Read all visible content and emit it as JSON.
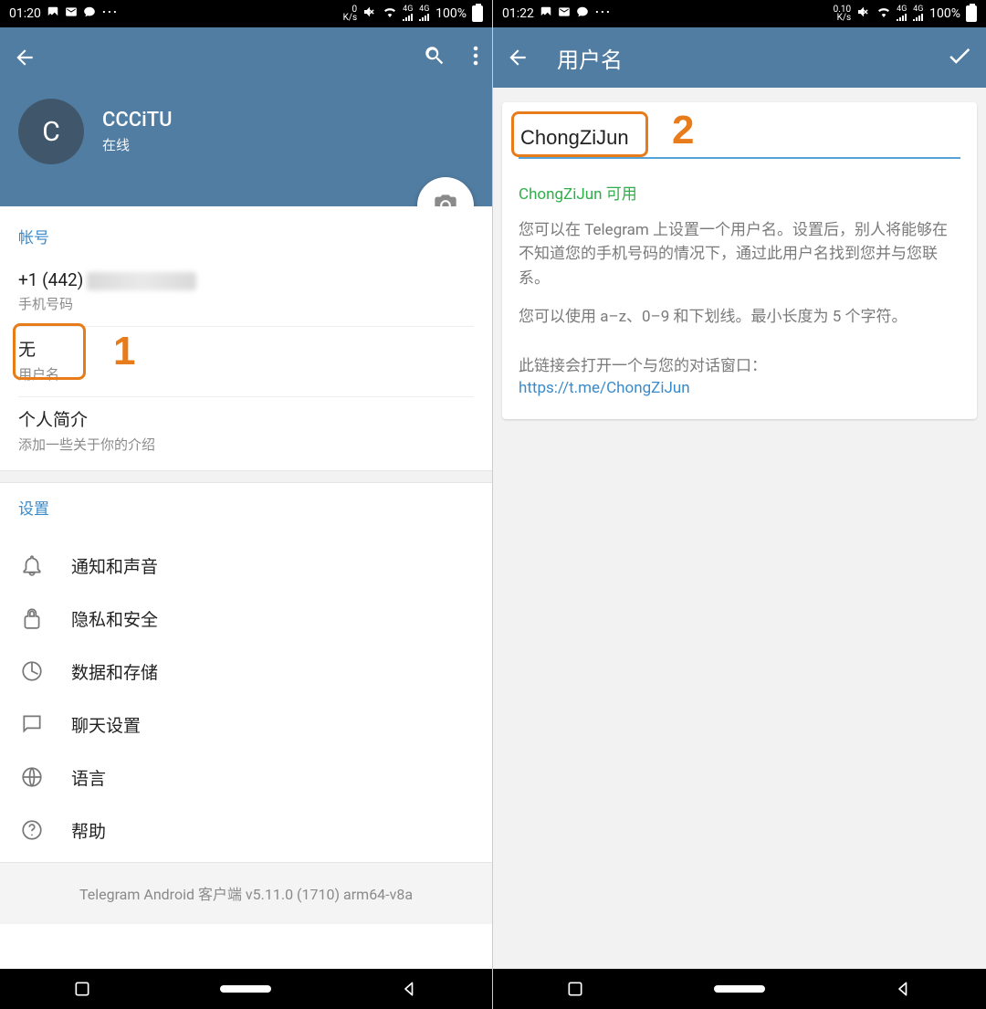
{
  "left": {
    "statusbar": {
      "time": "01:20",
      "ks_top": "0",
      "ks_bottom": "K/s",
      "battery": "100%"
    },
    "profile": {
      "avatar_initial": "C",
      "name": "CCCiTU",
      "status": "在线"
    },
    "account": {
      "section_title": "帐号",
      "phone": {
        "value": "+1 (442)",
        "label": "手机号码"
      },
      "username": {
        "value": "无",
        "label": "用户名"
      },
      "bio": {
        "value": "个人简介",
        "label": "添加一些关于你的介绍"
      }
    },
    "settings": {
      "section_title": "设置",
      "items": [
        {
          "label": "通知和声音"
        },
        {
          "label": "隐私和安全"
        },
        {
          "label": "数据和存储"
        },
        {
          "label": "聊天设置"
        },
        {
          "label": "语言"
        },
        {
          "label": "帮助"
        }
      ]
    },
    "footer": "Telegram Android 客户端 v5.11.0 (1710) arm64-v8a",
    "annotation": "1"
  },
  "right": {
    "statusbar": {
      "time": "01:22",
      "ks_top": "0.10",
      "ks_bottom": "K/s",
      "battery": "100%"
    },
    "appbar_title": "用户名",
    "username_value": "ChongZiJun",
    "username_status": "ChongZiJun 可用",
    "desc1": "您可以在 Telegram 上设置一个用户名。设置后，别人将能够在不知道您的手机号码的情况下，通过此用户名找到您并与您联系。",
    "desc2": "您可以使用 a–z、0–9 和下划线。最小长度为 5 个字符。",
    "link_label": "此链接会打开一个与您的对话窗口：",
    "link": "https://t.me/ChongZiJun",
    "annotation": "2"
  }
}
